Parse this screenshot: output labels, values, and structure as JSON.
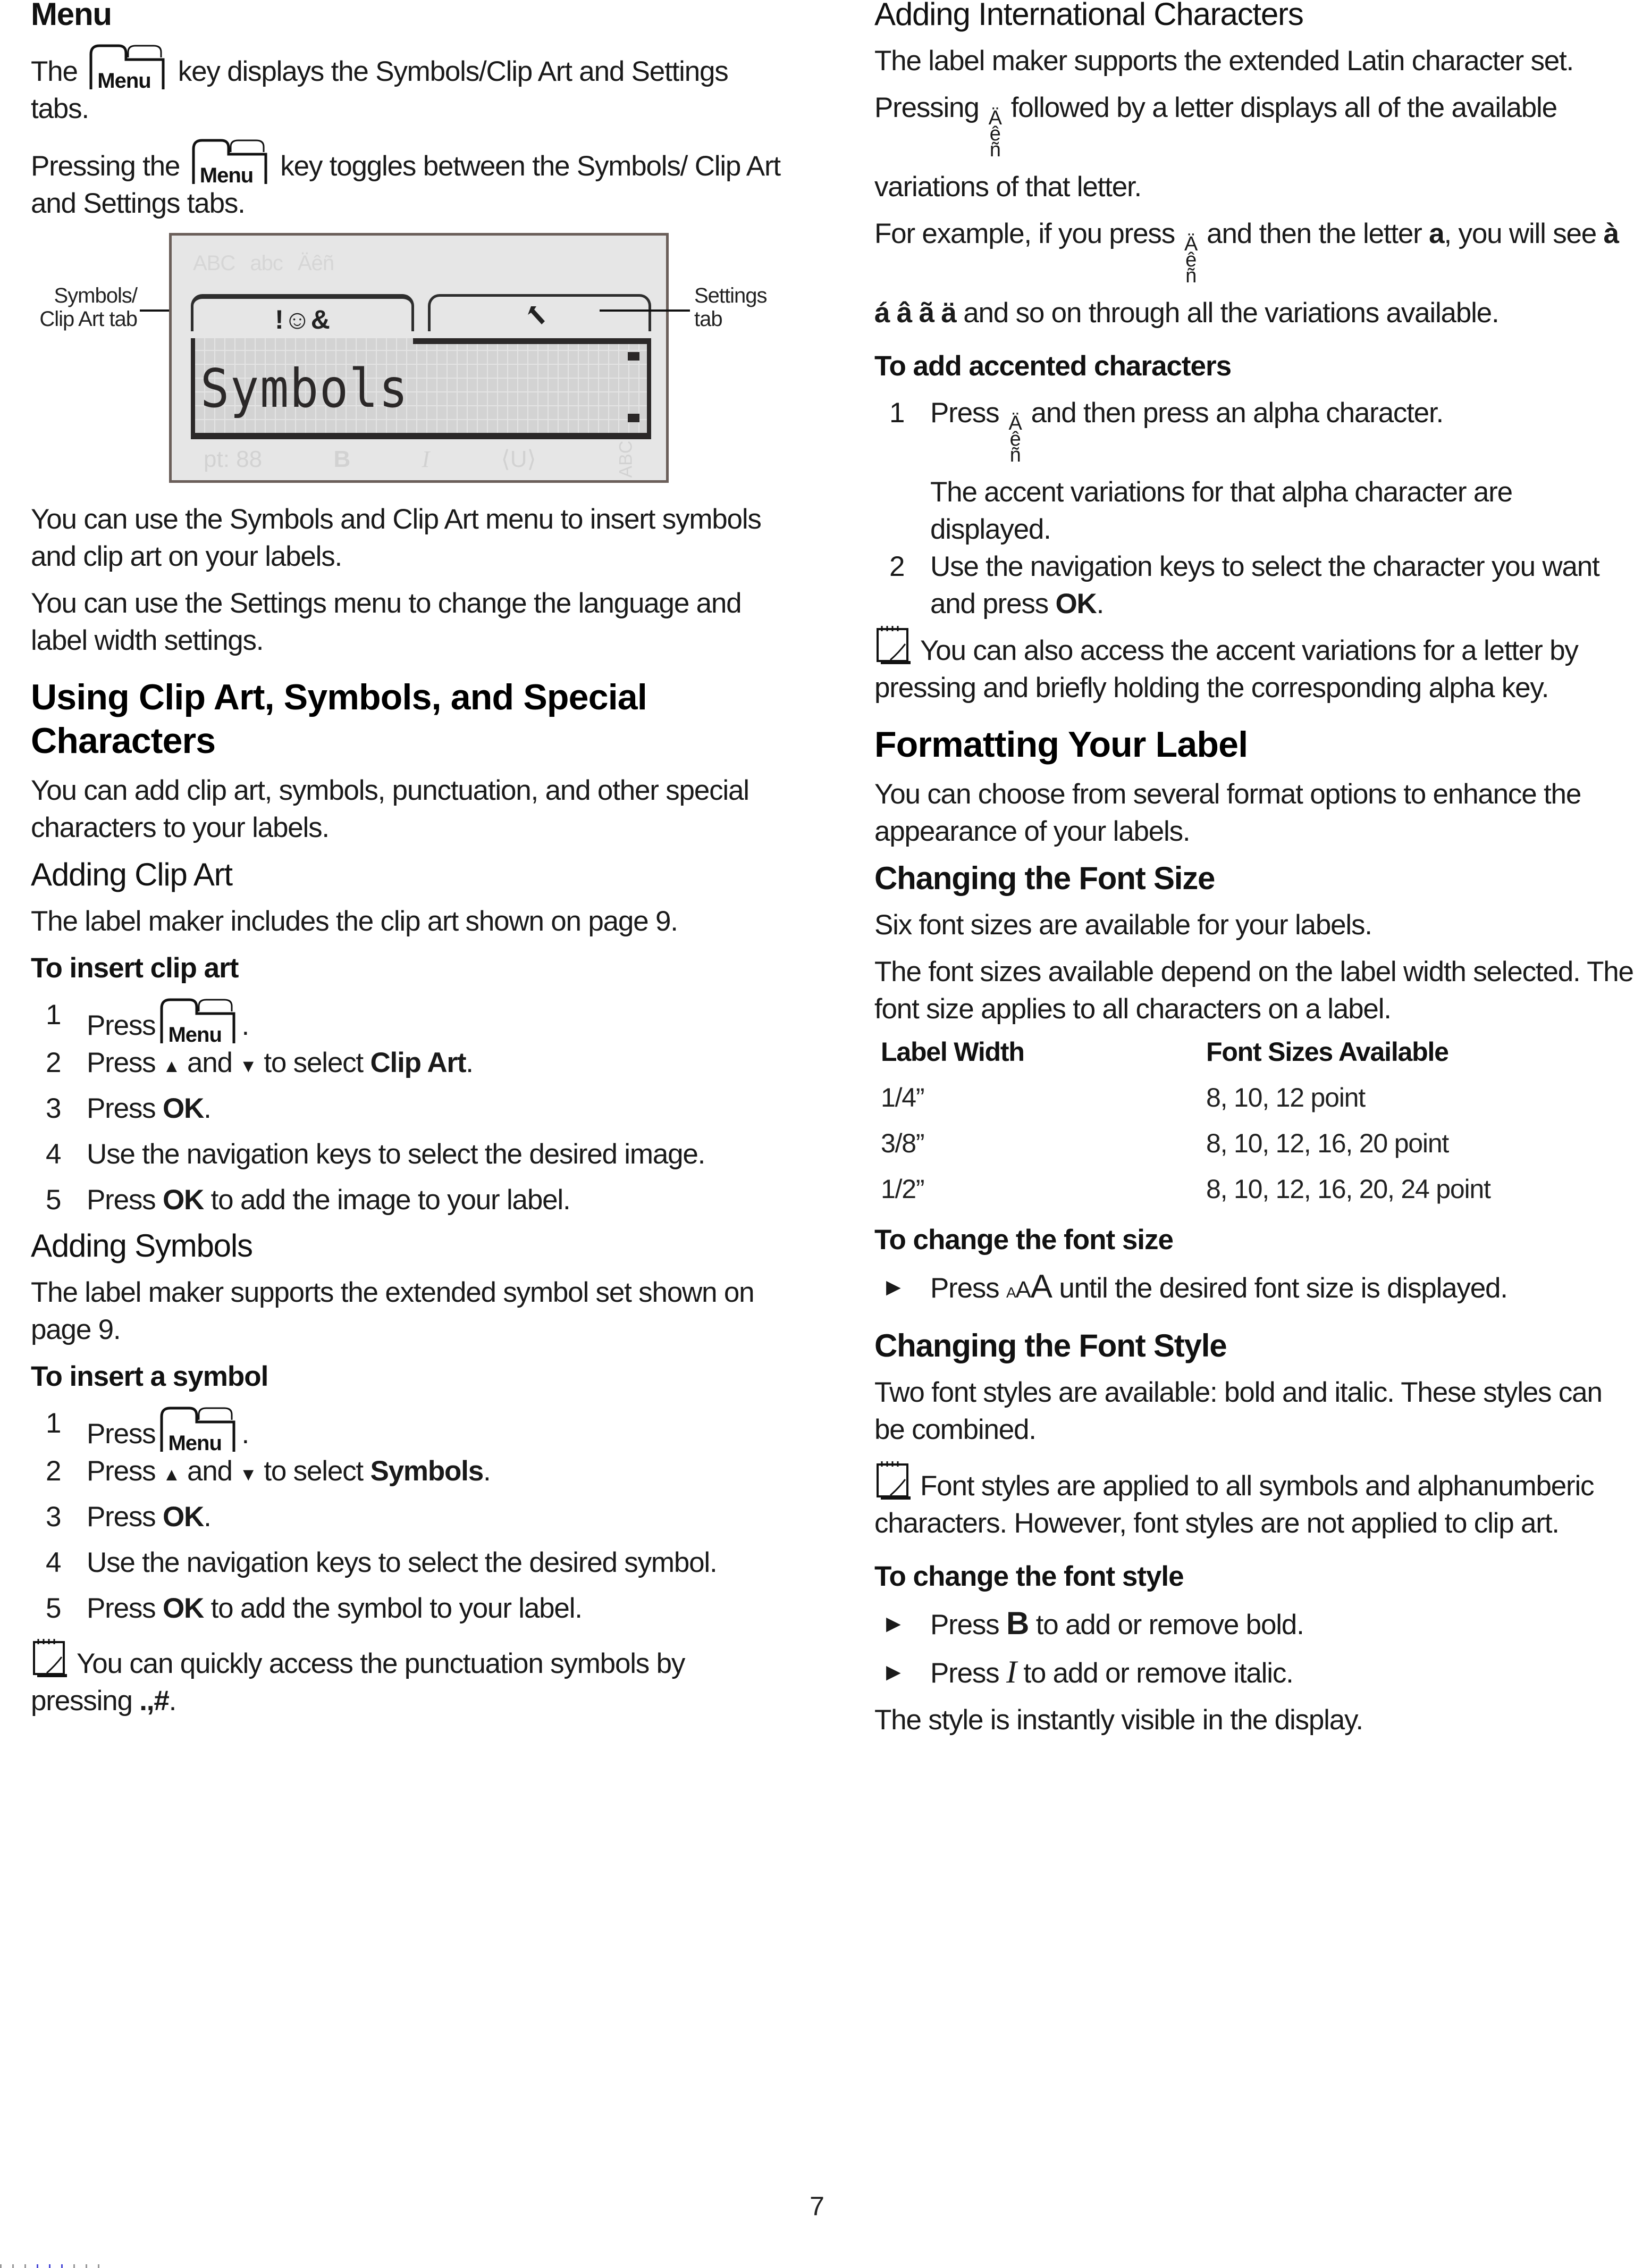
{
  "left": {
    "menu_heading": "Menu",
    "menu_p1_before": "The",
    "menu_p1_after": "key displays the Symbols/Clip Art and Settings tabs.",
    "menu_p2_before": "Pressing the",
    "menu_p2_after": "key toggles between the Symbols/ Clip Art and Settings tabs.",
    "menu_key_label": "Menu",
    "display": {
      "top_indicators": "ABC abc Äêñ",
      "tab_symbols_glyph": "!☺&",
      "tab_settings_glyph": "wrench",
      "screen_text": "Symbols",
      "bottom_indicators": [
        "pt: 88",
        "B",
        "I",
        "⟨U⟩",
        "ABC"
      ],
      "callout_left": "Symbols/\nClip Art tab",
      "callout_right": "Settings\ntab"
    },
    "p_symbols_menu": "You can use the Symbols and Clip Art menu to insert symbols and clip art on your labels.",
    "p_settings_menu": "You can use the Settings menu to change the language and label width settings.",
    "h_using": "Using Clip Art, Symbols, and Special Characters",
    "p_using": "You can add clip art, symbols, punctuation, and other special characters to your labels.",
    "h_clipart": "Adding Clip Art",
    "p_clipart": "The label maker includes the clip art shown on page 9.",
    "proc_clipart": "To insert clip art",
    "clipart_steps": {
      "s1_pre": "Press",
      "s1_post": ".",
      "s2_pre": "Press",
      "s2_mid": "and",
      "s2_post": "to select",
      "s2_bold": "Clip Art",
      "s2_end": ".",
      "s3_pre": "Press",
      "s3_bold": "OK",
      "s3_end": ".",
      "s4": "Use the navigation keys to select the desired image.",
      "s5_pre": "Press",
      "s5_bold": "OK",
      "s5_post": "to add the image to your label."
    },
    "h_symbols": "Adding Symbols",
    "p_symbols": "The label maker supports the extended symbol set shown on page 9.",
    "proc_symbols": "To insert a symbol",
    "symbol_steps": {
      "s1_pre": "Press",
      "s1_post": ".",
      "s2_pre": "Press",
      "s2_mid": "and",
      "s2_post": "to select",
      "s2_bold": "Symbols",
      "s2_end": ".",
      "s3_pre": "Press",
      "s3_bold": "OK",
      "s3_end": ".",
      "s4": "Use the navigation keys to select the desired symbol.",
      "s5_pre": "Press",
      "s5_bold": "OK",
      "s5_post": "to add the symbol to your label."
    },
    "note_punct_pre": "You can quickly access the punctuation symbols by pressing",
    "note_punct_key": ".,#",
    "note_punct_end": "."
  },
  "right": {
    "h_intl": "Adding International Characters",
    "p_intl": "The label maker supports the extended Latin character set.",
    "p_press_pre": "Pressing",
    "p_press_post": "followed by a letter displays all of the available variations of that letter.",
    "accent_key": [
      "Ä",
      "ê",
      "ñ"
    ],
    "p_example_pre": "For example, if you press",
    "p_example_mid": "and then the letter",
    "p_example_letter": "a",
    "p_example_comma": ",",
    "p_example_line2_pre": "you will see",
    "p_example_variants": "à á â ã ä",
    "p_example_line2_post": "and so on through all the variations available.",
    "proc_accent": "To add accented characters",
    "accent_steps": {
      "s1_pre": "Press",
      "s1_post": "and then press an alpha character.",
      "s1_sub": "The accent variations for that alpha character are displayed.",
      "s2_pre": "Use the navigation keys to select the character you want and press",
      "s2_bold": "OK",
      "s2_end": "."
    },
    "note_accent": "You can also access the accent variations for a letter by pressing and briefly holding the corresponding alpha key.",
    "h_format": "Formatting Your Label",
    "p_format": "You can choose from several format options to enhance the appearance of your labels.",
    "h_fontsize": "Changing the Font Size",
    "p_fontsize1": "Six font sizes are available for your labels.",
    "p_fontsize2": "The font sizes available depend on the label width selected. The font size applies to all characters on a label.",
    "table": {
      "headers": [
        "Label Width",
        "Font Sizes Available"
      ],
      "rows": [
        [
          "1/4”",
          "8, 10, 12 point"
        ],
        [
          "3/8”",
          "8, 10, 12, 16, 20 point"
        ],
        [
          "1/2”",
          "8, 10, 12, 16, 20, 24 point"
        ]
      ]
    },
    "proc_fontsize": "To change the font size",
    "fontsize_bullet_pre": "Press",
    "fontsize_key": "AAA",
    "fontsize_bullet_post": "until the desired font size is displayed.",
    "h_fontstyle": "Changing the Font Style",
    "p_fontstyle": "Two font styles are available: bold and italic. These styles can be combined.",
    "note_fontstyle": "Font styles are applied to all symbols and alphanumberic characters. However, font styles are not applied to clip art.",
    "proc_fontstyle": "To change the font style",
    "bold_pre": "Press",
    "bold_key": "B",
    "bold_post": "to add or remove bold.",
    "italic_pre": "Press",
    "italic_key": "I",
    "italic_post": "to add or remove italic.",
    "p_style_visible": "The style is instantly visible in the display."
  },
  "page_number": "7"
}
